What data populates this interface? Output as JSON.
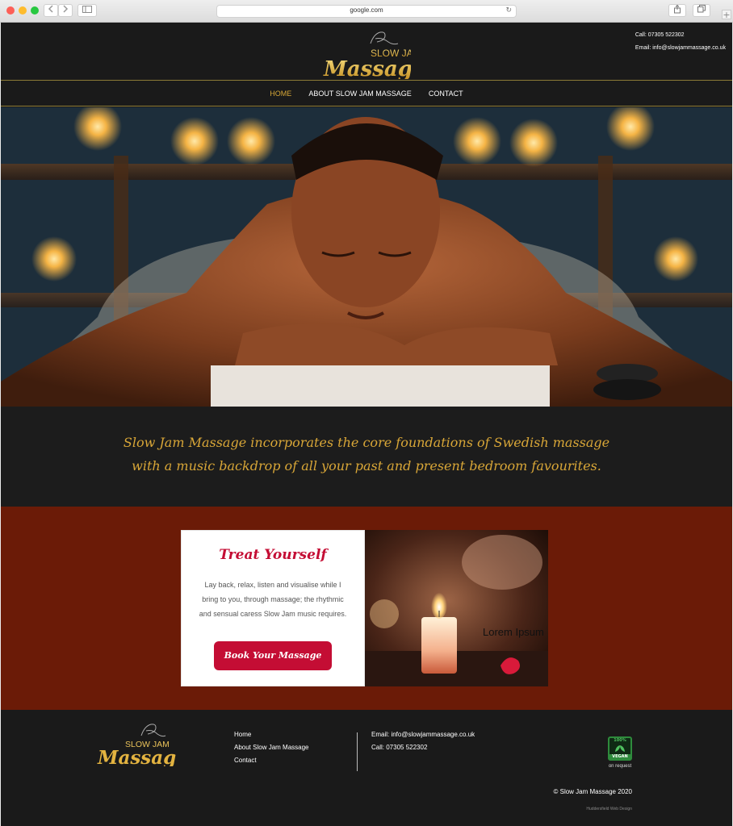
{
  "browser": {
    "url": "google.com",
    "back_icon": "chevron-left-icon",
    "forward_icon": "chevron-right-icon",
    "sidebar_icon": "sidebar-icon",
    "reload_icon": "reload-icon",
    "share_icon": "share-icon",
    "tabs_icon": "tabs-icon",
    "new_tab_label": "+"
  },
  "header": {
    "logo": {
      "top": "SLOW JAM",
      "bottom": "Massage"
    },
    "phone": "Call: 07305 522302",
    "email": "Email: info@slowjammassage.co.uk"
  },
  "nav": {
    "items": [
      {
        "label": "HOME"
      },
      {
        "label": "ABOUT SLOW JAM MASSAGE"
      },
      {
        "label": "CONTACT"
      }
    ]
  },
  "tagline": {
    "line1": "Slow Jam Massage incorporates the core foundations of Swedish massage",
    "line2": "with a music backdrop of all your past and present bedroom favourites."
  },
  "promo": {
    "title": "Treat Yourself",
    "text": "Lay back, relax, listen and visualise while I bring to you, through massage; the rhythmic and sensual caress Slow Jam music requires.",
    "button": "Book Your Massage",
    "image_caption": "Lorem Ipsum"
  },
  "footer": {
    "logo": {
      "top": "SLOW JAM",
      "bottom": "Massage"
    },
    "links": [
      "Home",
      "About Slow Jam Massage",
      "Contact"
    ],
    "email": "Email: info@slowjammassage.co.uk",
    "phone": "Call: 07305 522302",
    "vegan_badge": {
      "top": "100%",
      "bottom": "VEGAN",
      "caption": "on request"
    },
    "copyright": "© Slow Jam Massage 2020",
    "credit": "Huddersfield Web Design"
  },
  "colors": {
    "gold": "#d6a736",
    "crimson": "#c40d34",
    "band_red": "#6b1b07",
    "dark": "#1a1a1a"
  }
}
